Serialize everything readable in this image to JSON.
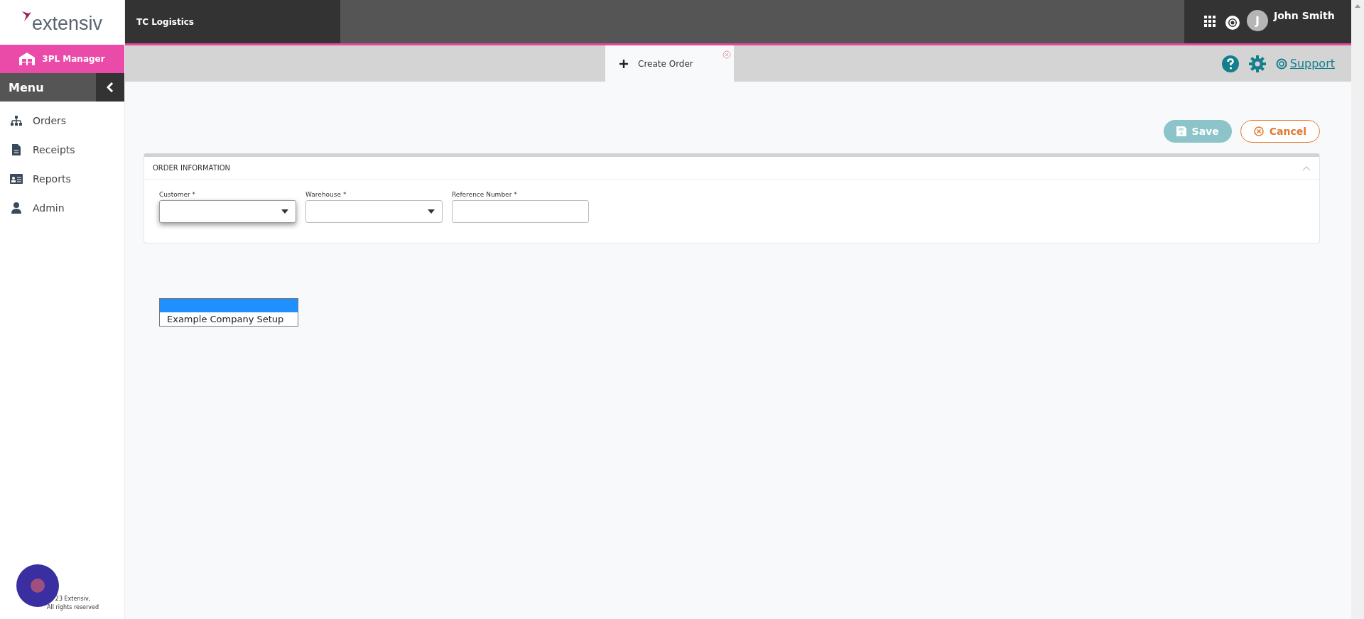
{
  "brand": {
    "logo": "extensiv",
    "product": "3PL Manager"
  },
  "topbar": {
    "company": "TC Logistics",
    "user_initial": "J",
    "user_name": "John Smith"
  },
  "menu": {
    "title": "Menu",
    "items": [
      {
        "label": "Orders"
      },
      {
        "label": "Receipts"
      },
      {
        "label": "Reports"
      },
      {
        "label": "Admin"
      }
    ]
  },
  "tabs": [
    {
      "label": "Create Order",
      "selected": true
    }
  ],
  "toolbar": {
    "support": "Support"
  },
  "actions": {
    "save": {
      "label": "Save",
      "disabled": true
    },
    "cancel": {
      "label": "Cancel"
    }
  },
  "section": {
    "title": "ORDER INFORMATION",
    "expanded": true,
    "fields": [
      {
        "label": "Customer *",
        "kind": "select",
        "focused": true
      },
      {
        "label": "Warehouse *",
        "kind": "select",
        "focused": false
      },
      {
        "label": "Reference Number *",
        "kind": "text",
        "focused": false
      }
    ]
  },
  "dropdown": {
    "options": [
      {
        "selected": true
      },
      {
        "label": "Example Company Setup",
        "selected": false
      }
    ]
  },
  "footer": {
    "lines": [
      "23 Extensiv,",
      "All rights reserved"
    ]
  }
}
